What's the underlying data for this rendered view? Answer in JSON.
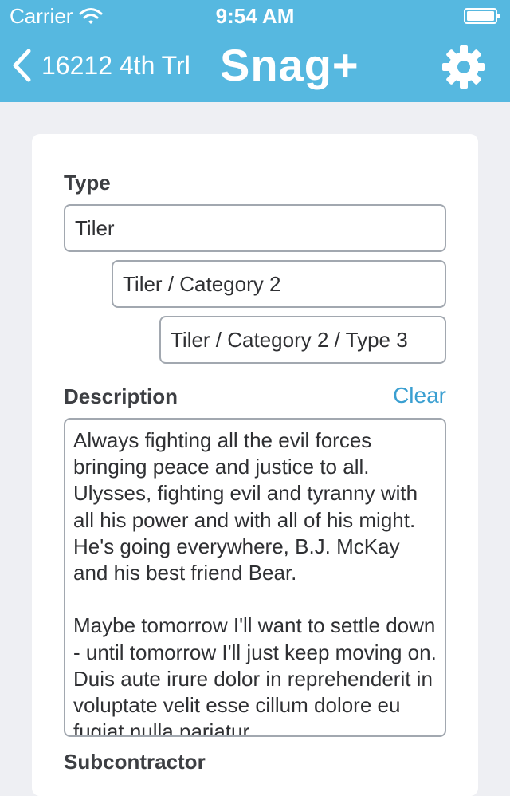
{
  "status_bar": {
    "carrier": "Carrier",
    "time": "9:54 AM"
  },
  "nav": {
    "back_label": "16212 4th Trl",
    "logo": "Snag+",
    "accent_color": "#56b8e0"
  },
  "form": {
    "type_label": "Type",
    "type_levels": [
      "Tiler",
      "Tiler / Category 2",
      "Tiler / Category 2 / Type 3"
    ],
    "description_label": "Description",
    "clear_label": "Clear",
    "description_text": "Always fighting all the evil forces bringing peace and justice to all. Ulysses, fighting evil and tyranny with all his power and with all of his might. He's going everywhere, B.J. McKay and his best friend Bear.\n\nMaybe tomorrow I'll want to settle down - until tomorrow I'll just keep moving on. Duis aute irure dolor in reprehenderit in voluptate velit esse cillum dolore eu fugiat nulla pariatur.",
    "next_section_label": "Subcontractor"
  }
}
